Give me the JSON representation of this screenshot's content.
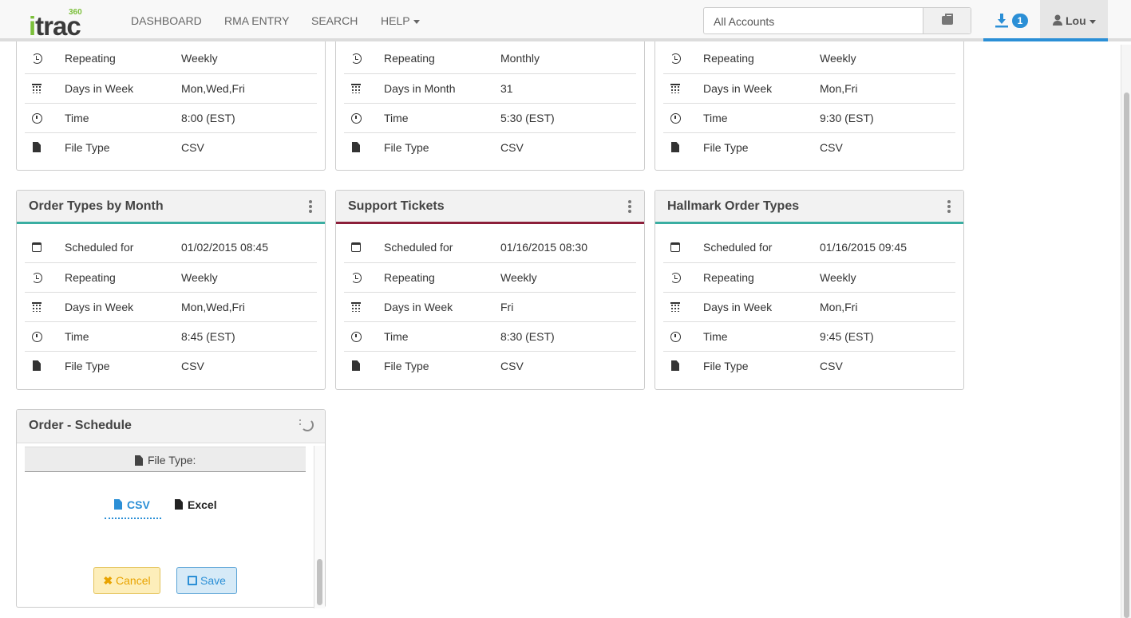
{
  "nav": {
    "logo_text": "itrac",
    "logo_sup": "360",
    "links": [
      "DASHBOARD",
      "RMA ENTRY",
      "SEARCH",
      "HELP"
    ],
    "accounts_value": "All Accounts",
    "download_count": "1",
    "user": "Lou"
  },
  "top_cards": [
    {
      "rows": [
        {
          "label": "Repeating",
          "value": "Weekly"
        },
        {
          "label": "Days in Week",
          "value": "Mon,Wed,Fri"
        },
        {
          "label": "Time",
          "value": "8:00 (EST)"
        },
        {
          "label": "File Type",
          "value": "CSV"
        }
      ]
    },
    {
      "rows": [
        {
          "label": "Repeating",
          "value": "Monthly"
        },
        {
          "label": "Days in Month",
          "value": "31"
        },
        {
          "label": "Time",
          "value": "5:30 (EST)"
        },
        {
          "label": "File Type",
          "value": "CSV"
        }
      ]
    },
    {
      "rows": [
        {
          "label": "Repeating",
          "value": "Weekly"
        },
        {
          "label": "Days in Week",
          "value": "Mon,Fri"
        },
        {
          "label": "Time",
          "value": "9:30 (EST)"
        },
        {
          "label": "File Type",
          "value": "CSV"
        }
      ]
    }
  ],
  "cards": [
    {
      "title": "Order Types by Month",
      "accent": "#3aaea2",
      "rows": [
        {
          "label": "Scheduled for",
          "value": "01/02/2015 08:45"
        },
        {
          "label": "Repeating",
          "value": "Weekly"
        },
        {
          "label": "Days in Week",
          "value": "Mon,Wed,Fri"
        },
        {
          "label": "Time",
          "value": "8:45 (EST)"
        },
        {
          "label": "File Type",
          "value": "CSV"
        }
      ]
    },
    {
      "title": "Support Tickets",
      "accent": "#8c1f3a",
      "rows": [
        {
          "label": "Scheduled for",
          "value": "01/16/2015 08:30"
        },
        {
          "label": "Repeating",
          "value": "Weekly"
        },
        {
          "label": "Days in Week",
          "value": "Fri"
        },
        {
          "label": "Time",
          "value": "8:30 (EST)"
        },
        {
          "label": "File Type",
          "value": "CSV"
        }
      ]
    },
    {
      "title": "Hallmark Order Types",
      "accent": "#3aaea2",
      "rows": [
        {
          "label": "Scheduled for",
          "value": "01/16/2015 09:45"
        },
        {
          "label": "Repeating",
          "value": "Weekly"
        },
        {
          "label": "Days in Week",
          "value": "Mon,Fri"
        },
        {
          "label": "Time",
          "value": "9:45 (EST)"
        },
        {
          "label": "File Type",
          "value": "CSV"
        }
      ]
    }
  ],
  "schedule": {
    "title": "Order - Schedule",
    "file_type_label": "File Type:",
    "options": [
      "CSV",
      "Excel"
    ],
    "selected": "CSV",
    "cancel_label": "Cancel",
    "save_label": "Save"
  }
}
